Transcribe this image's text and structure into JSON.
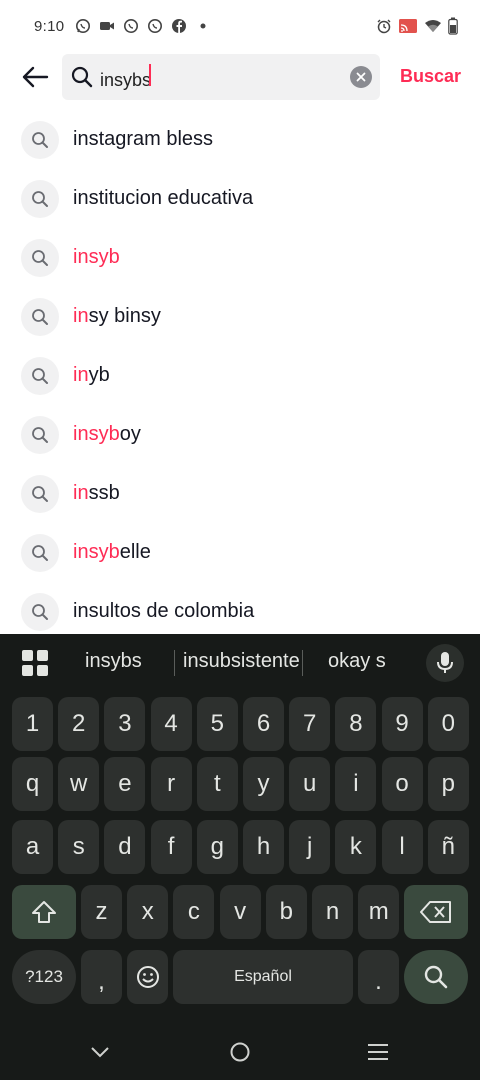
{
  "status_bar": {
    "time": "9:10",
    "left_icons": [
      "whatsapp-icon",
      "video-icon",
      "whatsapp-icon",
      "whatsapp-icon",
      "facebook-icon",
      "dot-icon"
    ],
    "right_icons": [
      "alarm-icon",
      "cast-icon",
      "wifi-icon",
      "battery-icon"
    ]
  },
  "search": {
    "value": "insybs",
    "button_label": "Buscar",
    "accent_color": "#fe2c55"
  },
  "suggestions": [
    {
      "highlight": "",
      "rest": "instagram bless"
    },
    {
      "highlight": "",
      "rest": "institucion educativa"
    },
    {
      "highlight": "insyb",
      "rest": ""
    },
    {
      "highlight": "in",
      "rest": "sy binsy"
    },
    {
      "highlight": "in",
      "rest": "yb"
    },
    {
      "highlight": "insyb",
      "rest": "oy"
    },
    {
      "highlight": "in",
      "rest": "ssb"
    },
    {
      "highlight": "insyb",
      "rest": "elle"
    },
    {
      "highlight": "",
      "rest": "insultos de colombia"
    }
  ],
  "keyboard": {
    "suggestions": [
      "insybs",
      "insubsistente",
      "okay s"
    ],
    "row_numbers": [
      "1",
      "2",
      "3",
      "4",
      "5",
      "6",
      "7",
      "8",
      "9",
      "0"
    ],
    "row1": [
      "q",
      "w",
      "e",
      "r",
      "t",
      "y",
      "u",
      "i",
      "o",
      "p"
    ],
    "row2": [
      "a",
      "s",
      "d",
      "f",
      "g",
      "h",
      "j",
      "k",
      "l",
      "ñ"
    ],
    "row3": [
      "z",
      "x",
      "c",
      "v",
      "b",
      "n",
      "m"
    ],
    "symbols_label": "?123",
    "comma_label": ",",
    "space_label": "Español",
    "period_label": "."
  }
}
